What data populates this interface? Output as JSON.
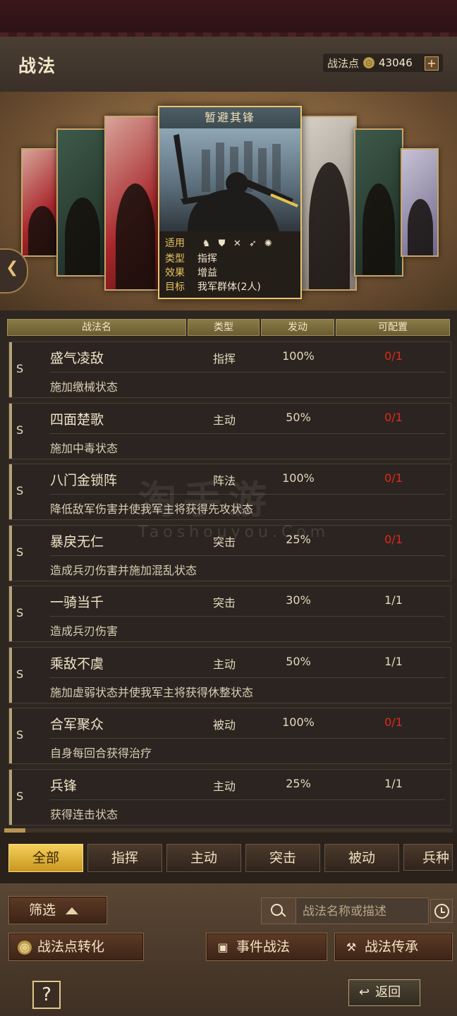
{
  "header": {
    "title": "战法",
    "points_label": "战法点",
    "points_value": "43046",
    "plus": "+"
  },
  "featured": {
    "name": "暂避其锋",
    "rows": [
      {
        "key": "适用",
        "value": ""
      },
      {
        "key": "类型",
        "value": "指挥"
      },
      {
        "key": "效果",
        "value": "增益"
      },
      {
        "key": "目标",
        "value": "我军群体(2人)"
      }
    ],
    "applicable_icons": [
      "cavalry-icon",
      "shield-icon",
      "bow-icon",
      "spear-icon",
      "wheel-icon"
    ]
  },
  "columns": [
    "战法名",
    "类型",
    "发动",
    "可配置"
  ],
  "skills": [
    {
      "grade": "S",
      "name": "盛气凌敌",
      "type": "指挥",
      "rate": "100%",
      "config": "0/1",
      "desc": "施加缴械状态",
      "config_full": true
    },
    {
      "grade": "S",
      "name": "四面楚歌",
      "type": "主动",
      "rate": "50%",
      "config": "0/1",
      "desc": "施加中毒状态",
      "config_full": true
    },
    {
      "grade": "S",
      "name": "八门金锁阵",
      "type": "阵法",
      "rate": "100%",
      "config": "0/1",
      "desc": "降低敌军伤害并使我军主将获得先攻状态",
      "config_full": true
    },
    {
      "grade": "S",
      "name": "暴戾无仁",
      "type": "突击",
      "rate": "25%",
      "config": "0/1",
      "desc": "造成兵刃伤害并施加混乱状态",
      "config_full": true
    },
    {
      "grade": "S",
      "name": "一骑当千",
      "type": "突击",
      "rate": "30%",
      "config": "1/1",
      "desc": "造成兵刃伤害",
      "config_full": false
    },
    {
      "grade": "S",
      "name": "乘敌不虞",
      "type": "主动",
      "rate": "50%",
      "config": "1/1",
      "desc": "施加虚弱状态并使我军主将获得休整状态",
      "config_full": false
    },
    {
      "grade": "S",
      "name": "合军聚众",
      "type": "被动",
      "rate": "100%",
      "config": "0/1",
      "desc": "自身每回合获得治疗",
      "config_full": true
    },
    {
      "grade": "S",
      "name": "兵锋",
      "type": "主动",
      "rate": "25%",
      "config": "1/1",
      "desc": "获得连击状态",
      "config_full": false
    }
  ],
  "watermark": {
    "main": "淘手游",
    "sub": "Taoshouyou.Com"
  },
  "tabs": [
    "全部",
    "指挥",
    "主动",
    "突击",
    "被动",
    "兵种"
  ],
  "controls": {
    "filter": "筛选",
    "search_placeholder": "战法名称或描述",
    "convert": "战法点转化",
    "event": "事件战法",
    "inherit": "战法传承",
    "help": "?",
    "back": "返回"
  },
  "colors": {
    "accent_gold": "#e8c66f",
    "config_red": "#e02a1e",
    "active_tab": "#f4cf5a"
  }
}
